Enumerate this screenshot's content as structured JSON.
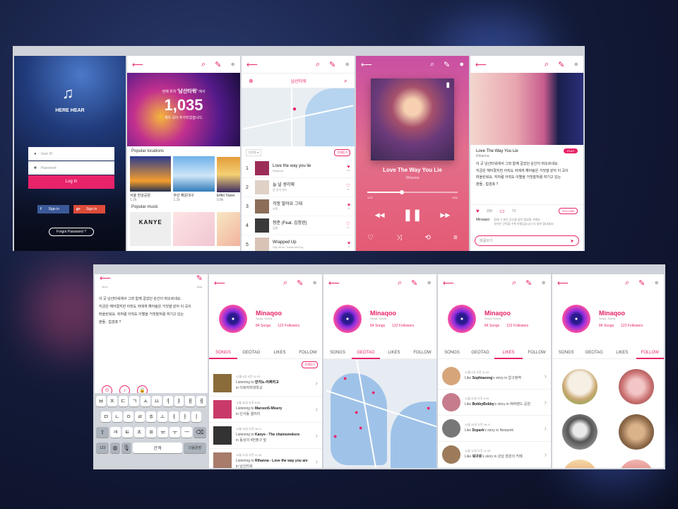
{
  "login": {
    "brand": "HERE HEAR",
    "id_ph": "User ID",
    "pw_ph": "Password",
    "login_btn": "Log In",
    "fb": "Sign in",
    "g": "Sign in",
    "forgot": "Forgot Password ?"
  },
  "home": {
    "line1": "현재 위치",
    "place": "'남산타워'",
    "line1b": "에서",
    "count": "1,035",
    "line2": "개의 곡이 추가되었습니다.",
    "sec1": "Popular locations",
    "locs": [
      {
        "name": "서울 한강공원",
        "cnt": "1.2k"
      },
      {
        "name": "부산 해운대구",
        "cnt": "1.1k"
      },
      {
        "name": "Eiffel Tower",
        "cnt": "0.8k"
      }
    ],
    "sec2": "Popular music",
    "kanye": "KANYE"
  },
  "chart": {
    "search": "남산타워",
    "sort": "인기순 ▾",
    "playall": "전체듣기",
    "items": [
      {
        "n": "1",
        "t": "Love the way you lie",
        "a": "Rihanna",
        "c": "870"
      },
      {
        "n": "2",
        "t": "늘 널 생각해",
        "a": "윤 성석 왼드",
        "c": "48"
      },
      {
        "n": "3",
        "t": "걱정 말아요 그대",
        "a": "이적",
        "c": "51"
      },
      {
        "n": "4",
        "t": "청춘 (Feat. 김창완)",
        "a": "김필",
        "c": "44"
      },
      {
        "n": "5",
        "t": "Wrapped Up",
        "a": "Olly Murs, Travie McCoy",
        "c": "21"
      }
    ]
  },
  "player": {
    "title": "Love The Way You Lie",
    "artist": "Rihanna",
    "cur": "1:07",
    "total": "3:51"
  },
  "detail": {
    "title": "Love The Way You Lie",
    "artist": "Rihanna",
    "play": "PLAY",
    "text1": "이 곳 남산타워에서 그와 함께 걸었던 순간이 떠오르네요.",
    "text2": "지금은 헤어졌지만 아직도 저에게 해어림은 거짓말 같아 이 곡이",
    "text3": "떠올린워요. 저처럼 아직도 이별을 거짓말처럼 여기고 있는",
    "text4": "분들.. 힘겠죠 ?",
    "likes": "150",
    "comments": "73",
    "follow": "FOLLOW",
    "cm_user": "Minaqoo",
    "cm1": "원래 그 분도 당신을 많이 많았을 거예요.",
    "cm2": "추억은 간직할 수록 아름답습니다 다 들어 힘내세요!",
    "cm_ph": "댓글쓰기"
  },
  "compose": {
    "back": "BACK",
    "save": "SAVE",
    "p1": "이 곳 남산타워에서 그와 함께 걸었던 순간이 떠오르네요.",
    "p2": "지금은 헤어졌지만 아직도 저에게 해어림은 거짓말 같아 이 곡이",
    "p3": "떠올린워요. 저처럼 아직도 이별을 거짓말처럼 여기고 있는",
    "p4": "분들.. 힘겠죠 ?",
    "r1": [
      "ㅂ",
      "ㅈ",
      "ㄷ",
      "ㄱ",
      "ㅅ",
      "ㅛ",
      "ㅕ",
      "ㅑ",
      "ㅐ",
      "ㅔ"
    ],
    "r2": [
      "ㅁ",
      "ㄴ",
      "ㅇ",
      "ㄹ",
      "ㅎ",
      "ㅗ",
      "ㅓ",
      "ㅏ",
      "ㅣ"
    ],
    "r3": [
      "ㅋ",
      "ㅌ",
      "ㅊ",
      "ㅍ",
      "ㅠ",
      "ㅜ",
      "ㅡ"
    ],
    "k123": "123",
    "space": "간격",
    "next": "다음문장"
  },
  "profile": {
    "name": "Minaqoo",
    "loc": "Seoul, Korea",
    "songs": "84 Songs",
    "followers": "122 Followers",
    "tabs": [
      "SONGS",
      "GEOTAG",
      "LIKES",
      "FOLLOW"
    ],
    "playall": "전체듣기"
  },
  "songs": [
    {
      "d": "12월 4일 오전 11:25",
      "l": "Listening to",
      "s": "반지노-어쩌라고",
      "m": "in 이화여자대학교"
    },
    {
      "d": "11월 30일 오후 6:05",
      "l": "Listening to",
      "s": "Maroon5-Misery",
      "m": "in 인사동 갤러리"
    },
    {
      "d": "11월 29일 오전 06:11",
      "l": "Listening to",
      "s": "Kanye - The chainsmokers",
      "m": "in 동상의 4번출구 앞"
    },
    {
      "d": "11월 12일 오전 11:39",
      "l": "Listening to",
      "s": "Rihanna - Love the way you are",
      "m": "in 남산타워"
    }
  ],
  "likes": [
    {
      "d": "12월 4일 오전 11:25",
      "u": "Sophiaeong",
      "rest": "'s story in 압구정역"
    },
    {
      "d": "11월 30일 오후 6:05",
      "u": "BobbyBobby",
      "rest": "'s story in 에버랜드 공원"
    },
    {
      "d": "11월 29일 오전 06:11",
      "u": "Dzpark",
      "rest": "'s story in Newyork"
    },
    {
      "d": "11월 12일 오전 11:39",
      "u": "워구르",
      "rest": "'s story in 강남 잠원의 카페"
    }
  ]
}
